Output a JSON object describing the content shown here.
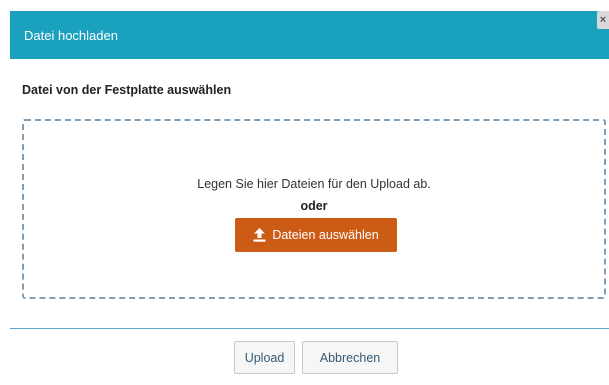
{
  "dialog": {
    "title": "Datei hochladen",
    "close_label": "×"
  },
  "section": {
    "heading": "Datei von der Festplatte auswählen"
  },
  "dropzone": {
    "instruction": "Legen Sie hier Dateien für den Upload ab.",
    "separator": "oder",
    "choose_button_label": "Dateien auswählen",
    "choose_button_icon": "upload-icon"
  },
  "footer": {
    "upload_label": "Upload",
    "cancel_label": "Abbrechen"
  },
  "colors": {
    "header_bg": "#1aa1bd",
    "accent_button": "#cc5b16",
    "dropzone_border": "#7f9db5",
    "divider": "#58a9c8"
  }
}
